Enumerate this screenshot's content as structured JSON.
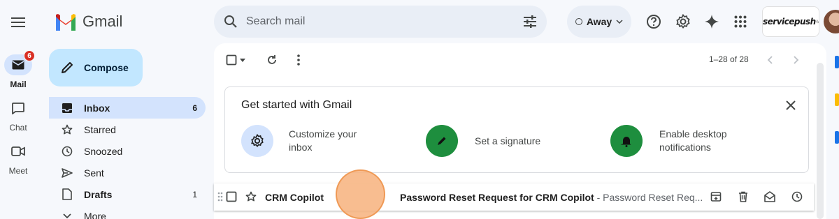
{
  "app": {
    "name": "Gmail"
  },
  "search": {
    "placeholder": "Search mail"
  },
  "status": {
    "label": "Away"
  },
  "brand": {
    "label": "servicepush"
  },
  "rail": [
    {
      "label": "Mail",
      "badge": "6"
    },
    {
      "label": "Chat"
    },
    {
      "label": "Meet"
    }
  ],
  "compose": {
    "label": "Compose"
  },
  "nav": {
    "inbox": {
      "label": "Inbox",
      "count": "6"
    },
    "starred": {
      "label": "Starred"
    },
    "snoozed": {
      "label": "Snoozed"
    },
    "sent": {
      "label": "Sent"
    },
    "drafts": {
      "label": "Drafts",
      "count": "1"
    },
    "more": {
      "label": "More"
    }
  },
  "toolbar": {
    "pager": "1–28 of 28"
  },
  "get_started": {
    "title": "Get started with Gmail",
    "tips": [
      {
        "line1": "Customize your",
        "line2": "inbox"
      },
      {
        "line1": "Set a signature"
      },
      {
        "line1": "Enable desktop",
        "line2": "notifications"
      }
    ]
  },
  "email": {
    "sender": "CRM Copilot",
    "subject": "Password Reset Request for CRM Copilot",
    "snippet": " - Password Reset Req..."
  },
  "colors": {
    "accent": "#d3e3fd",
    "compose": "#c2e7ff",
    "tip_green": "#1e8e3e",
    "tip_blue": "#d3e3fd",
    "badge": "#d93025"
  },
  "icons": [
    "menu-icon",
    "gmail-logo",
    "search-icon",
    "tune-icon",
    "help-icon",
    "settings-icon",
    "gemini-icon",
    "apps-icon",
    "mail-icon",
    "chat-icon",
    "meet-icon",
    "pencil-icon",
    "inbox-icon",
    "star-icon",
    "clock-icon",
    "send-icon",
    "draft-icon",
    "chevron-down-icon",
    "checkbox-icon",
    "refresh-icon",
    "more-vert-icon",
    "chevron-left-icon",
    "chevron-right-icon",
    "close-icon",
    "gear-icon",
    "pen-icon",
    "bell-icon",
    "drag-icon",
    "archive-icon",
    "trash-icon",
    "mark-read-icon",
    "snooze-icon"
  ]
}
